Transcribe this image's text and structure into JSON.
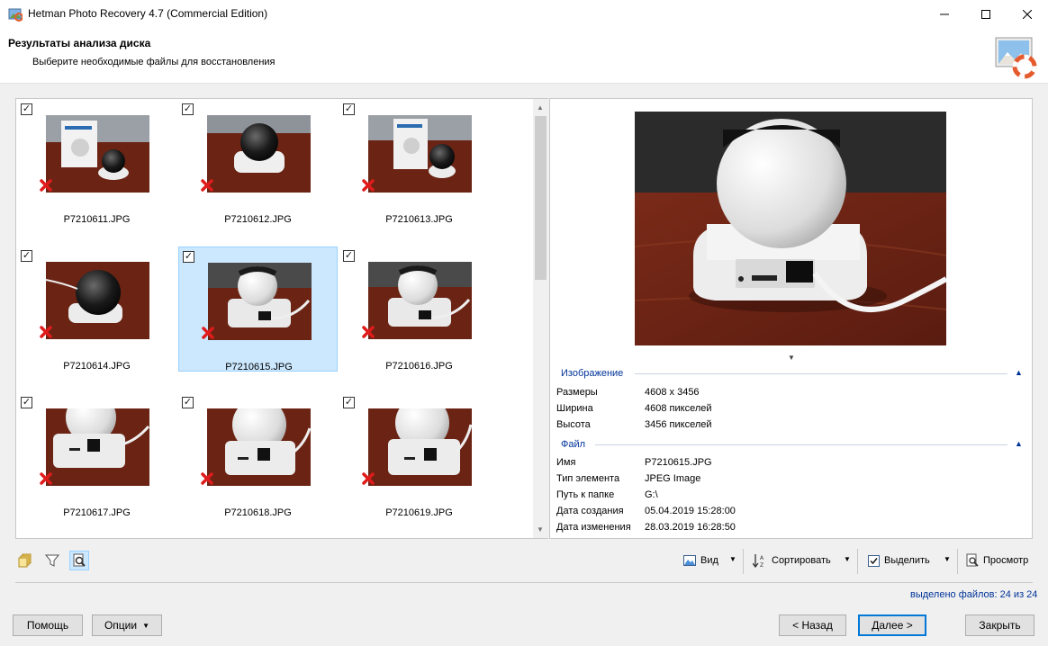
{
  "window": {
    "title": "Hetman Photo Recovery 4.7 (Commercial Edition)"
  },
  "header": {
    "title": "Результаты анализа диска",
    "subtitle": "Выберите необходимые файлы для восстановления"
  },
  "thumbnails": [
    {
      "name": "P7210611.JPG",
      "checked": true,
      "selected": false
    },
    {
      "name": "P7210612.JPG",
      "checked": true,
      "selected": false
    },
    {
      "name": "P7210613.JPG",
      "checked": true,
      "selected": false
    },
    {
      "name": "P7210614.JPG",
      "checked": true,
      "selected": false
    },
    {
      "name": "P7210615.JPG",
      "checked": true,
      "selected": true
    },
    {
      "name": "P7210616.JPG",
      "checked": true,
      "selected": false
    },
    {
      "name": "P7210617.JPG",
      "checked": true,
      "selected": false
    },
    {
      "name": "P7210618.JPG",
      "checked": true,
      "selected": false
    },
    {
      "name": "P7210619.JPG",
      "checked": true,
      "selected": false
    }
  ],
  "properties": {
    "image_section": "Изображение",
    "image": [
      {
        "label": "Размеры",
        "value": "4608 x 3456"
      },
      {
        "label": "Ширина",
        "value": "4608 пикселей"
      },
      {
        "label": "Высота",
        "value": "3456 пикселей"
      }
    ],
    "file_section": "Файл",
    "file": [
      {
        "label": "Имя",
        "value": "P7210615.JPG"
      },
      {
        "label": "Тип элемента",
        "value": "JPEG Image"
      },
      {
        "label": "Путь к папке",
        "value": "G:\\"
      },
      {
        "label": "Дата создания",
        "value": "05.04.2019 15:28:00"
      },
      {
        "label": "Дата изменения",
        "value": "28.03.2019 16:28:50"
      }
    ]
  },
  "toolbar": {
    "view_label": "Вид",
    "sort_label": "Сортировать",
    "select_label": "Выделить",
    "preview_label": "Просмотр"
  },
  "status": {
    "files_selected": "выделено файлов: 24 из 24"
  },
  "buttons": {
    "help": "Помощь",
    "options": "Опции",
    "back": "< Назад",
    "next": "Далее >",
    "close": "Закрыть"
  },
  "colors": {
    "selection_bg": "#cce8ff",
    "selection_border": "#99d1ff",
    "section_title": "#003399",
    "delete_mark": "#e01b1b"
  }
}
